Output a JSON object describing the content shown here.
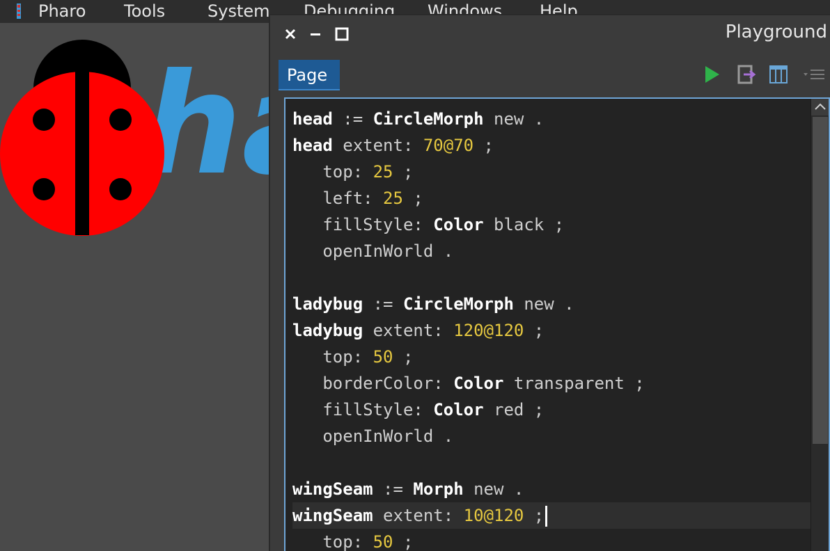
{
  "menubar": {
    "items": [
      "Pharo",
      "Tools",
      "System",
      "Debugging",
      "Windows",
      "Help"
    ]
  },
  "desktop": {
    "logo_text": "ha"
  },
  "window": {
    "title": "Playground",
    "tabs": [
      "Page"
    ]
  },
  "editor": {
    "lines": [
      [
        {
          "t": "head",
          "s": "kw"
        },
        {
          "t": " := "
        },
        {
          "t": "CircleMorph",
          "s": "kw"
        },
        {
          "t": " new ."
        }
      ],
      [
        {
          "t": "head",
          "s": "kw"
        },
        {
          "t": " extent: "
        },
        {
          "t": "70@70",
          "s": "num"
        },
        {
          "t": " ;"
        }
      ],
      [
        {
          "t": "   top: "
        },
        {
          "t": "25",
          "s": "num"
        },
        {
          "t": " ;"
        }
      ],
      [
        {
          "t": "   left: "
        },
        {
          "t": "25",
          "s": "num"
        },
        {
          "t": " ;"
        }
      ],
      [
        {
          "t": "   fillStyle: "
        },
        {
          "t": "Color",
          "s": "kw"
        },
        {
          "t": " black ;"
        }
      ],
      [
        {
          "t": "   openInWorld ."
        }
      ],
      [],
      [
        {
          "t": "ladybug",
          "s": "kw"
        },
        {
          "t": " := "
        },
        {
          "t": "CircleMorph",
          "s": "kw"
        },
        {
          "t": " new ."
        }
      ],
      [
        {
          "t": "ladybug",
          "s": "kw"
        },
        {
          "t": " extent: "
        },
        {
          "t": "120@120",
          "s": "num"
        },
        {
          "t": " ;"
        }
      ],
      [
        {
          "t": "   top: "
        },
        {
          "t": "50",
          "s": "num"
        },
        {
          "t": " ;"
        }
      ],
      [
        {
          "t": "   borderColor: "
        },
        {
          "t": "Color",
          "s": "kw"
        },
        {
          "t": " transparent ;"
        }
      ],
      [
        {
          "t": "   fillStyle: "
        },
        {
          "t": "Color",
          "s": "kw"
        },
        {
          "t": " red ;"
        }
      ],
      [
        {
          "t": "   openInWorld ."
        }
      ],
      [],
      [
        {
          "t": "wingSeam",
          "s": "kw"
        },
        {
          "t": " := "
        },
        {
          "t": "Morph",
          "s": "kw"
        },
        {
          "t": " new ."
        }
      ],
      [
        {
          "t": "wingSeam",
          "s": "kw"
        },
        {
          "t": " extent: "
        },
        {
          "t": "10@120",
          "s": "num"
        },
        {
          "t": " ;"
        }
      ],
      [
        {
          "t": "   top: "
        },
        {
          "t": "50",
          "s": "num"
        },
        {
          "t": " ;"
        }
      ]
    ],
    "current_line": 15
  },
  "colors": {
    "menubar_bg": "#2d2d2d",
    "desktop_bg": "#4a4a4a",
    "editor_bg": "#232323",
    "keyword": "#ffffff",
    "number": "#e6c840",
    "tab_active": "#1e5a94",
    "run_green": "#2fb34a",
    "pharo_blue": "#3a9ad9",
    "ladybug_red": "#ff0000"
  },
  "icons": [
    "pharo-logo-icon",
    "close-icon",
    "minimize-icon",
    "maximize-icon",
    "run-icon",
    "inspect-icon",
    "columns-icon",
    "menu-icon"
  ]
}
